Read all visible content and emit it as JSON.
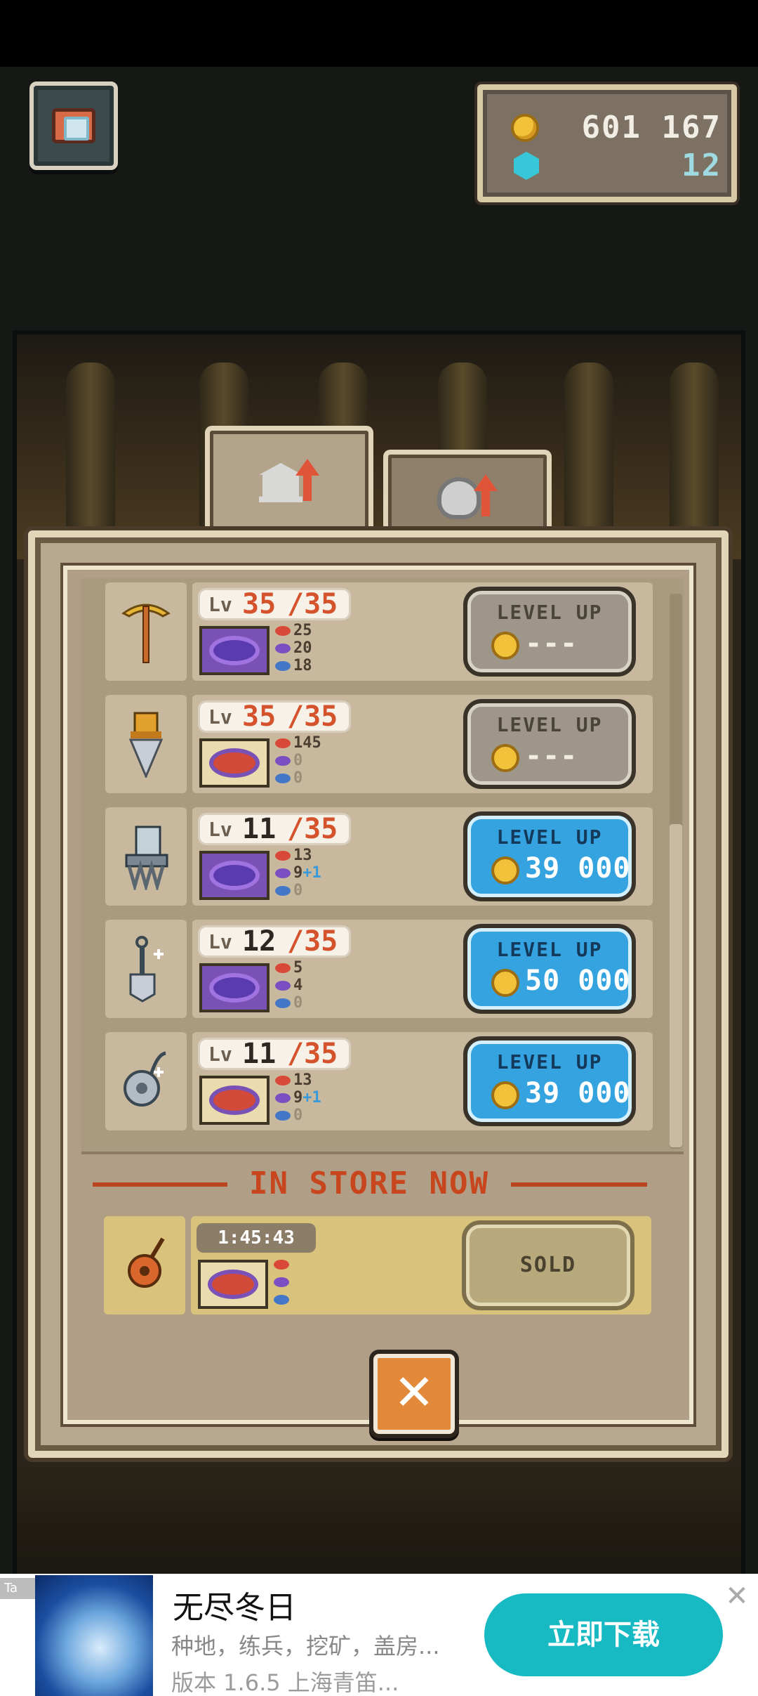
{
  "currency": {
    "gold": "601 167",
    "gems": "12"
  },
  "tabs": [
    {
      "icon": "museum-upgrade-icon"
    },
    {
      "icon": "helmet-upgrade-icon"
    }
  ],
  "upgrades": [
    {
      "tool": "pickaxe-icon",
      "lv_prefix": "Lv",
      "level": "35",
      "max": "/35",
      "stats": [
        "25",
        "20",
        "18"
      ],
      "bonus": [
        "",
        "",
        ""
      ],
      "button_title": "LEVEL UP",
      "price": "---",
      "state": "disabled"
    },
    {
      "tool": "drill-icon",
      "lv_prefix": "Lv",
      "level": "35",
      "max": "/35",
      "stats": [
        "145",
        "0",
        "0"
      ],
      "bonus": [
        "",
        "",
        ""
      ],
      "button_title": "LEVEL UP",
      "price": "---",
      "state": "disabled"
    },
    {
      "tool": "excavator-claw-icon",
      "lv_prefix": "Lv",
      "level": "11",
      "max": "/35",
      "stats": [
        "13",
        "9",
        "0"
      ],
      "bonus": [
        "",
        "+1",
        ""
      ],
      "button_title": "LEVEL UP",
      "price": "39 000",
      "state": "enabled"
    },
    {
      "tool": "shovel-icon",
      "lv_prefix": "Lv",
      "level": "12",
      "max": "/35",
      "stats": [
        "5",
        "4",
        "0"
      ],
      "bonus": [
        "",
        "",
        ""
      ],
      "button_title": "LEVEL UP",
      "price": "50 000",
      "state": "enabled"
    },
    {
      "tool": "saw-blade-icon",
      "lv_prefix": "Lv",
      "level": "11",
      "max": "/35",
      "stats": [
        "13",
        "9",
        "0"
      ],
      "bonus": [
        "",
        "+1",
        ""
      ],
      "button_title": "LEVEL UP",
      "price": "39 000",
      "state": "enabled"
    }
  ],
  "store": {
    "title": "IN STORE NOW",
    "timer": "1:45:43",
    "item_icon": "guitar-icon",
    "button": "SOLD"
  },
  "close_label": "✕",
  "ad": {
    "tag": "Ta",
    "title": "无尽冬日",
    "desc": "种地，练兵，挖矿，盖房...",
    "version": "版本 1.6.5 上海青笛...",
    "cta": "立即下载",
    "close": "✕"
  },
  "colors": {
    "accent_blue": "#35a3e0",
    "max_level_orange": "#d5532c",
    "store_red": "#c8461d",
    "ad_teal": "#17b9c3"
  }
}
